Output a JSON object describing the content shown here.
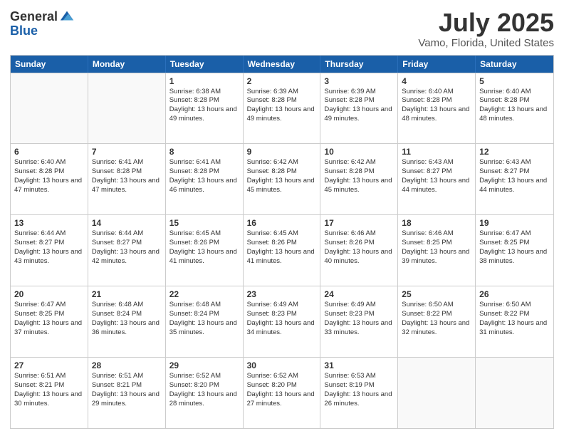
{
  "logo": {
    "general": "General",
    "blue": "Blue"
  },
  "header": {
    "month_year": "July 2025",
    "location": "Vamo, Florida, United States"
  },
  "weekdays": [
    "Sunday",
    "Monday",
    "Tuesday",
    "Wednesday",
    "Thursday",
    "Friday",
    "Saturday"
  ],
  "weeks": [
    [
      {
        "day": "",
        "info": ""
      },
      {
        "day": "",
        "info": ""
      },
      {
        "day": "1",
        "info": "Sunrise: 6:38 AM\nSunset: 8:28 PM\nDaylight: 13 hours and 49 minutes."
      },
      {
        "day": "2",
        "info": "Sunrise: 6:39 AM\nSunset: 8:28 PM\nDaylight: 13 hours and 49 minutes."
      },
      {
        "day": "3",
        "info": "Sunrise: 6:39 AM\nSunset: 8:28 PM\nDaylight: 13 hours and 49 minutes."
      },
      {
        "day": "4",
        "info": "Sunrise: 6:40 AM\nSunset: 8:28 PM\nDaylight: 13 hours and 48 minutes."
      },
      {
        "day": "5",
        "info": "Sunrise: 6:40 AM\nSunset: 8:28 PM\nDaylight: 13 hours and 48 minutes."
      }
    ],
    [
      {
        "day": "6",
        "info": "Sunrise: 6:40 AM\nSunset: 8:28 PM\nDaylight: 13 hours and 47 minutes."
      },
      {
        "day": "7",
        "info": "Sunrise: 6:41 AM\nSunset: 8:28 PM\nDaylight: 13 hours and 47 minutes."
      },
      {
        "day": "8",
        "info": "Sunrise: 6:41 AM\nSunset: 8:28 PM\nDaylight: 13 hours and 46 minutes."
      },
      {
        "day": "9",
        "info": "Sunrise: 6:42 AM\nSunset: 8:28 PM\nDaylight: 13 hours and 45 minutes."
      },
      {
        "day": "10",
        "info": "Sunrise: 6:42 AM\nSunset: 8:28 PM\nDaylight: 13 hours and 45 minutes."
      },
      {
        "day": "11",
        "info": "Sunrise: 6:43 AM\nSunset: 8:27 PM\nDaylight: 13 hours and 44 minutes."
      },
      {
        "day": "12",
        "info": "Sunrise: 6:43 AM\nSunset: 8:27 PM\nDaylight: 13 hours and 44 minutes."
      }
    ],
    [
      {
        "day": "13",
        "info": "Sunrise: 6:44 AM\nSunset: 8:27 PM\nDaylight: 13 hours and 43 minutes."
      },
      {
        "day": "14",
        "info": "Sunrise: 6:44 AM\nSunset: 8:27 PM\nDaylight: 13 hours and 42 minutes."
      },
      {
        "day": "15",
        "info": "Sunrise: 6:45 AM\nSunset: 8:26 PM\nDaylight: 13 hours and 41 minutes."
      },
      {
        "day": "16",
        "info": "Sunrise: 6:45 AM\nSunset: 8:26 PM\nDaylight: 13 hours and 41 minutes."
      },
      {
        "day": "17",
        "info": "Sunrise: 6:46 AM\nSunset: 8:26 PM\nDaylight: 13 hours and 40 minutes."
      },
      {
        "day": "18",
        "info": "Sunrise: 6:46 AM\nSunset: 8:25 PM\nDaylight: 13 hours and 39 minutes."
      },
      {
        "day": "19",
        "info": "Sunrise: 6:47 AM\nSunset: 8:25 PM\nDaylight: 13 hours and 38 minutes."
      }
    ],
    [
      {
        "day": "20",
        "info": "Sunrise: 6:47 AM\nSunset: 8:25 PM\nDaylight: 13 hours and 37 minutes."
      },
      {
        "day": "21",
        "info": "Sunrise: 6:48 AM\nSunset: 8:24 PM\nDaylight: 13 hours and 36 minutes."
      },
      {
        "day": "22",
        "info": "Sunrise: 6:48 AM\nSunset: 8:24 PM\nDaylight: 13 hours and 35 minutes."
      },
      {
        "day": "23",
        "info": "Sunrise: 6:49 AM\nSunset: 8:23 PM\nDaylight: 13 hours and 34 minutes."
      },
      {
        "day": "24",
        "info": "Sunrise: 6:49 AM\nSunset: 8:23 PM\nDaylight: 13 hours and 33 minutes."
      },
      {
        "day": "25",
        "info": "Sunrise: 6:50 AM\nSunset: 8:22 PM\nDaylight: 13 hours and 32 minutes."
      },
      {
        "day": "26",
        "info": "Sunrise: 6:50 AM\nSunset: 8:22 PM\nDaylight: 13 hours and 31 minutes."
      }
    ],
    [
      {
        "day": "27",
        "info": "Sunrise: 6:51 AM\nSunset: 8:21 PM\nDaylight: 13 hours and 30 minutes."
      },
      {
        "day": "28",
        "info": "Sunrise: 6:51 AM\nSunset: 8:21 PM\nDaylight: 13 hours and 29 minutes."
      },
      {
        "day": "29",
        "info": "Sunrise: 6:52 AM\nSunset: 8:20 PM\nDaylight: 13 hours and 28 minutes."
      },
      {
        "day": "30",
        "info": "Sunrise: 6:52 AM\nSunset: 8:20 PM\nDaylight: 13 hours and 27 minutes."
      },
      {
        "day": "31",
        "info": "Sunrise: 6:53 AM\nSunset: 8:19 PM\nDaylight: 13 hours and 26 minutes."
      },
      {
        "day": "",
        "info": ""
      },
      {
        "day": "",
        "info": ""
      }
    ]
  ]
}
